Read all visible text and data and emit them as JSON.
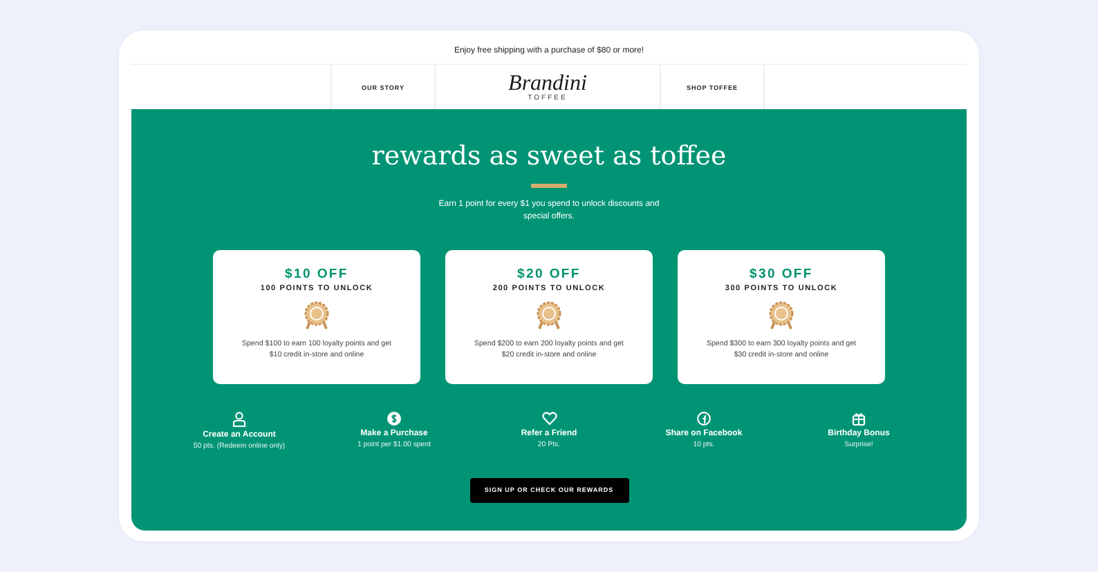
{
  "promo_bar": {
    "text": "Enjoy free shipping with a purchase of $80 or more!"
  },
  "nav": {
    "items": [
      {
        "label": "OUR STORY"
      },
      {
        "label": "SHOP TOFFEE"
      }
    ],
    "logo": {
      "name": "Brandini",
      "tagline": "TOFFEE"
    }
  },
  "hero": {
    "title": "rewards as sweet as toffee",
    "subtitle": "Earn 1 point for every $1 you spend to unlock discounts and special offers."
  },
  "rewards": [
    {
      "amount": "$10 OFF",
      "points": "100 POINTS TO UNLOCK",
      "description": "Spend $100 to earn 100 loyalty points and get $10 credit in-store and online"
    },
    {
      "amount": "$20 OFF",
      "points": "200 POINTS TO UNLOCK",
      "description": "Spend $200 to earn 200 loyalty points and get $20 credit in-store and online"
    },
    {
      "amount": "$30 OFF",
      "points": "300 POINTS TO UNLOCK",
      "description": "Spend $300 to earn 300 loyalty points and get $30 credit in-store and online"
    }
  ],
  "ways_to_earn": [
    {
      "kind": "account",
      "title": "Create an Account",
      "detail": "50 pts. (Redeem online only)"
    },
    {
      "kind": "purchase",
      "title": "Make a Purchase",
      "detail": "1 point per $1.00 spent"
    },
    {
      "kind": "refer",
      "title": "Refer a Friend",
      "detail": "20 Pts."
    },
    {
      "kind": "share",
      "title": "Share on Facebook",
      "detail": "10 pts."
    },
    {
      "kind": "birthday",
      "title": "Birthday Bonus",
      "detail": "Surprise!"
    }
  ],
  "cta": {
    "label": "SIGN UP OR CHECK OUR REWARDS"
  }
}
